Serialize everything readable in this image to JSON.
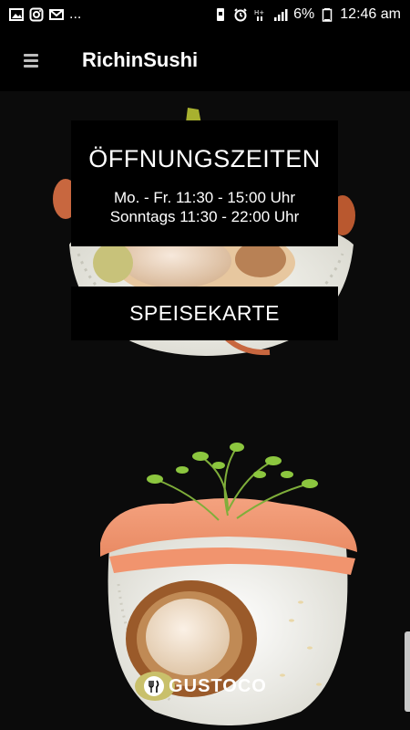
{
  "status_bar": {
    "time": "12:46 am",
    "battery": "6%",
    "more_indicator": "...",
    "left_icons": [
      "gallery-icon",
      "instagram-icon",
      "mail-icon"
    ],
    "right_icons": [
      "battery-saver-icon",
      "alarm-icon",
      "network-type-icon",
      "signal-icon",
      "battery-icon"
    ]
  },
  "app_bar": {
    "title": "RichinSushi",
    "menu_icon": "hamburger-icon"
  },
  "hours_card": {
    "title": "ÖFFNUNGSZEITEN",
    "lines": [
      "Mo. - Fr. 11:30 - 15:00 Uhr",
      "Sonntags 11:30 - 22:00 Uhr"
    ]
  },
  "menu_card": {
    "label": "SPEISEKARTE"
  },
  "footer_logo": {
    "text": "GUSTOCO"
  },
  "colors": {
    "background": "#0b0b0b",
    "card": "#000000",
    "text": "#ffffff"
  }
}
